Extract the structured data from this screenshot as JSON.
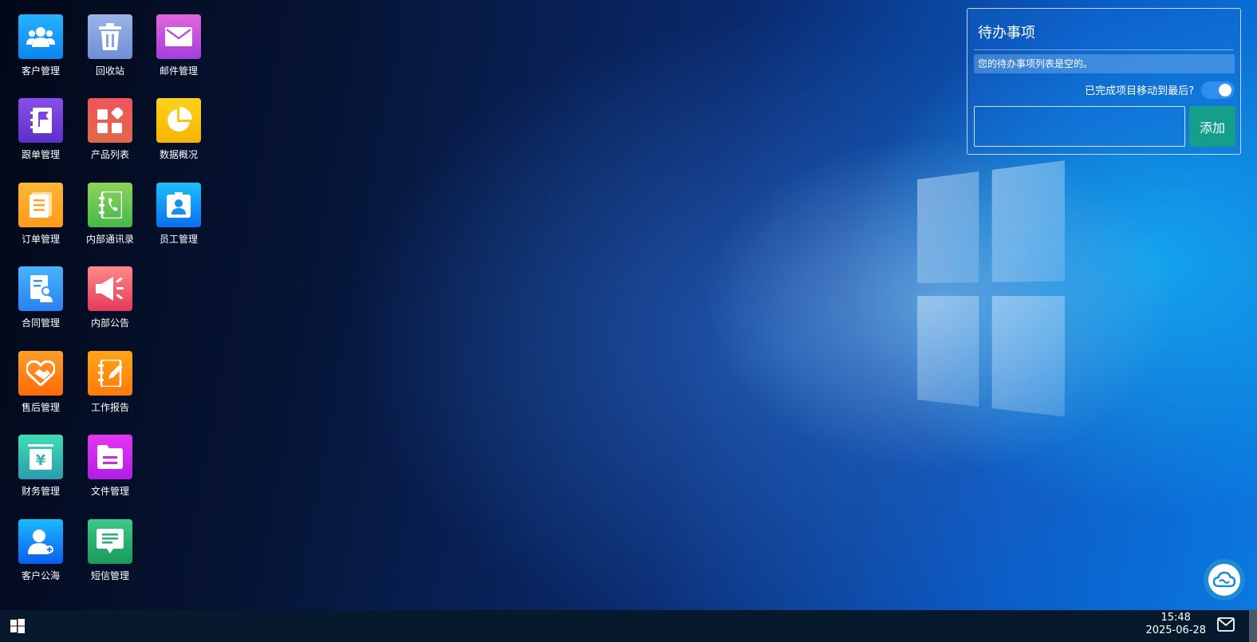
{
  "desktop_icons": [
    {
      "label": "客户管理",
      "icon": "users-icon",
      "color_top": "#28b2ff",
      "color_bottom": "#0a86f0"
    },
    {
      "label": "回收站",
      "icon": "trash-icon",
      "color_top": "#9bb4e6",
      "color_bottom": "#6e8fd6"
    },
    {
      "label": "邮件管理",
      "icon": "mail-icon",
      "color_top": "#e266dc",
      "color_bottom": "#a33fdc"
    },
    {
      "label": "跟单管理",
      "icon": "notebook-flag-icon",
      "color_top": "#8a4fe8",
      "color_bottom": "#5c2fc8"
    },
    {
      "label": "产品列表",
      "icon": "product-grid-icon",
      "color_top": "#f0545c",
      "color_bottom": "#e0684a"
    },
    {
      "label": "数据概况",
      "icon": "pie-chart-icon",
      "color_top": "#ffd21a",
      "color_bottom": "#f5b400"
    },
    {
      "label": "订单管理",
      "icon": "document-icon",
      "color_top": "#ffb733",
      "color_bottom": "#ff9a1a"
    },
    {
      "label": "内部通讯录",
      "icon": "phonebook-icon",
      "color_top": "#8ed45a",
      "color_bottom": "#45b84a"
    },
    {
      "label": "员工管理",
      "icon": "id-badge-icon",
      "color_top": "#1cc0ff",
      "color_bottom": "#0a6ff0"
    },
    {
      "label": "合同管理",
      "icon": "contract-icon",
      "color_top": "#48b4ff",
      "color_bottom": "#2a80f0"
    },
    {
      "label": "内部公告",
      "icon": "megaphone-icon",
      "color_top": "#ff8a8a",
      "color_bottom": "#e23a5a"
    },
    {
      "label": "售后管理",
      "icon": "handshake-heart-icon",
      "color_top": "#ff9e2a",
      "color_bottom": "#ff6a0a"
    },
    {
      "label": "工作报告",
      "icon": "report-edit-icon",
      "color_top": "#ffa61a",
      "color_bottom": "#ff7a0a"
    },
    {
      "label": "财务管理",
      "icon": "finance-yen-icon",
      "color_top": "#3ce0b4",
      "color_bottom": "#2a9cb0"
    },
    {
      "label": "文件管理",
      "icon": "folder-icon",
      "color_top": "#e436f0",
      "color_bottom": "#b21ee8"
    },
    {
      "label": "客户公海",
      "icon": "customer-pool-icon",
      "color_top": "#1cbaff",
      "color_bottom": "#0a5ef0"
    },
    {
      "label": "短信管理",
      "icon": "message-icon",
      "color_top": "#3cc88a",
      "color_bottom": "#1a9a5a"
    }
  ],
  "todo": {
    "title": "待办事项",
    "empty_text": "您的待办事项列表是空的。",
    "move_label": "已完成项目移动到最后?",
    "move_enabled": true,
    "input_value": "",
    "input_placeholder": "",
    "add_label": "添加"
  },
  "taskbar": {
    "time": "15:48",
    "date": "2025-06-28",
    "start_icon": "windows-icon",
    "mail_icon": "mail-outline-icon"
  },
  "colors": {
    "taskbar": "#071a2d",
    "add_button": "#159f8a",
    "toggle_on": "#2f8ff0"
  }
}
